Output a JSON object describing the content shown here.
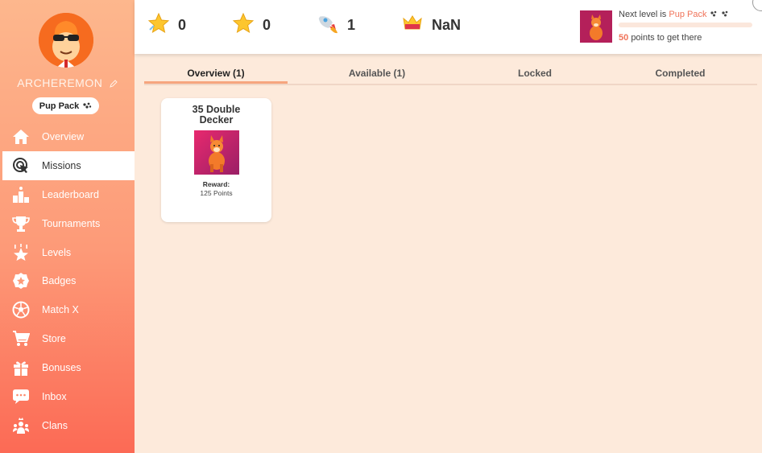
{
  "user": {
    "name": "ARCHEREMON",
    "level_badge": "Pup Pack"
  },
  "nav": {
    "items": [
      {
        "label": "Overview",
        "icon": "home-icon"
      },
      {
        "label": "Missions",
        "icon": "target-cursor-icon"
      },
      {
        "label": "Leaderboard",
        "icon": "podium-icon"
      },
      {
        "label": "Tournaments",
        "icon": "trophy-icon"
      },
      {
        "label": "Levels",
        "icon": "star-up-icon"
      },
      {
        "label": "Badges",
        "icon": "badge-icon"
      },
      {
        "label": "Match X",
        "icon": "ball-icon"
      },
      {
        "label": "Store",
        "icon": "cart-icon"
      },
      {
        "label": "Bonuses",
        "icon": "gift-icon"
      },
      {
        "label": "Inbox",
        "icon": "chat-icon"
      },
      {
        "label": "Clans",
        "icon": "clan-icon"
      }
    ],
    "active": "Missions"
  },
  "stats": {
    "points": "0",
    "stars": "0",
    "boosts": "1",
    "rank": "NaN"
  },
  "next_level": {
    "prefix": "Next level is",
    "level_name": "Pup Pack",
    "points_needed": "50",
    "points_suffix": "points to get there",
    "progress": 0
  },
  "tabs": [
    "Overview (1)",
    "Available (1)",
    "Locked",
    "Completed"
  ],
  "missions": [
    {
      "title": "35 Double Decker",
      "reward_label": "Reward:",
      "reward_value": "125 Points"
    }
  ],
  "colors": {
    "accent": "#f0745a",
    "sidebar_top": "#fdb78d",
    "sidebar_bottom": "#fc6a55",
    "background": "#fdeadb"
  }
}
